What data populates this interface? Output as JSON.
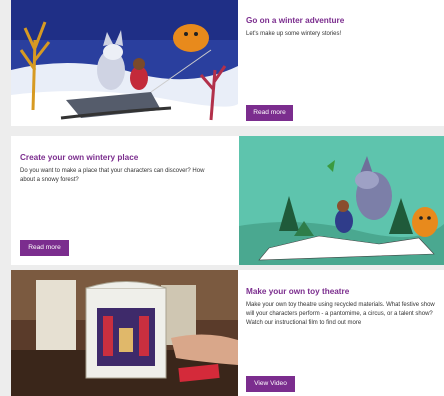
{
  "cards": [
    {
      "title": "Go on a winter adventure",
      "description": "Let's make up some wintery stories!",
      "button_label": "Read more"
    },
    {
      "title": "Create your own wintery place",
      "description": "Do you want to make a place that your characters can discover? How about a snowy forest?",
      "button_label": "Read more"
    },
    {
      "title": "Make your own toy theatre",
      "description": "Make your own toy theatre using recycled materials. What festive show will your characters perform - a pantomime, a circus, or a talent show? Watch our instructional film to find out more",
      "button_label": "View Video"
    }
  ],
  "colors": {
    "accent": "#7b2d8e",
    "page_background": "#ededed"
  }
}
